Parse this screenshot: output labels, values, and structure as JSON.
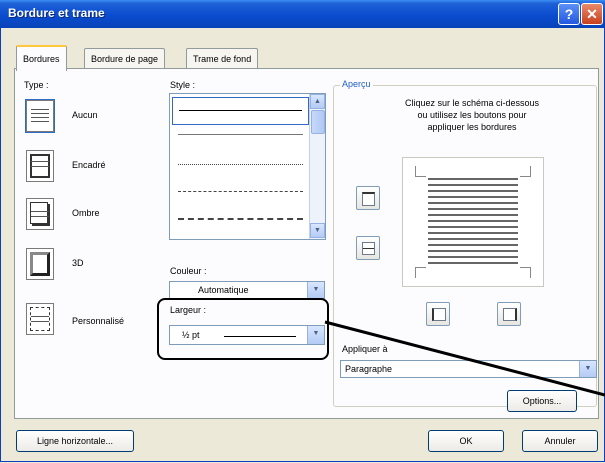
{
  "window": {
    "title": "Bordure et trame"
  },
  "tabs": [
    {
      "label": "Bordures"
    },
    {
      "label": "Bordure de page"
    },
    {
      "label": "Trame de fond"
    }
  ],
  "type": {
    "label": "Type :",
    "items": [
      "Aucun",
      "Encadré",
      "Ombre",
      "3D",
      "Personnalisé"
    ]
  },
  "style": {
    "label": "Style :"
  },
  "couleur": {
    "label": "Couleur :",
    "value": "Automatique"
  },
  "largeur": {
    "label": "Largeur :",
    "value": "½ pt"
  },
  "apercu": {
    "label": "Aperçu",
    "instructions": "Cliquez sur le schéma ci-dessous\nou utilisez les boutons pour\nappliquer les bordures"
  },
  "appliquer": {
    "label": "Appliquer à",
    "value": "Paragraphe"
  },
  "buttons": {
    "options": "Options...",
    "ligne": "Ligne horizontale...",
    "ok": "OK",
    "annuler": "Annuler"
  }
}
